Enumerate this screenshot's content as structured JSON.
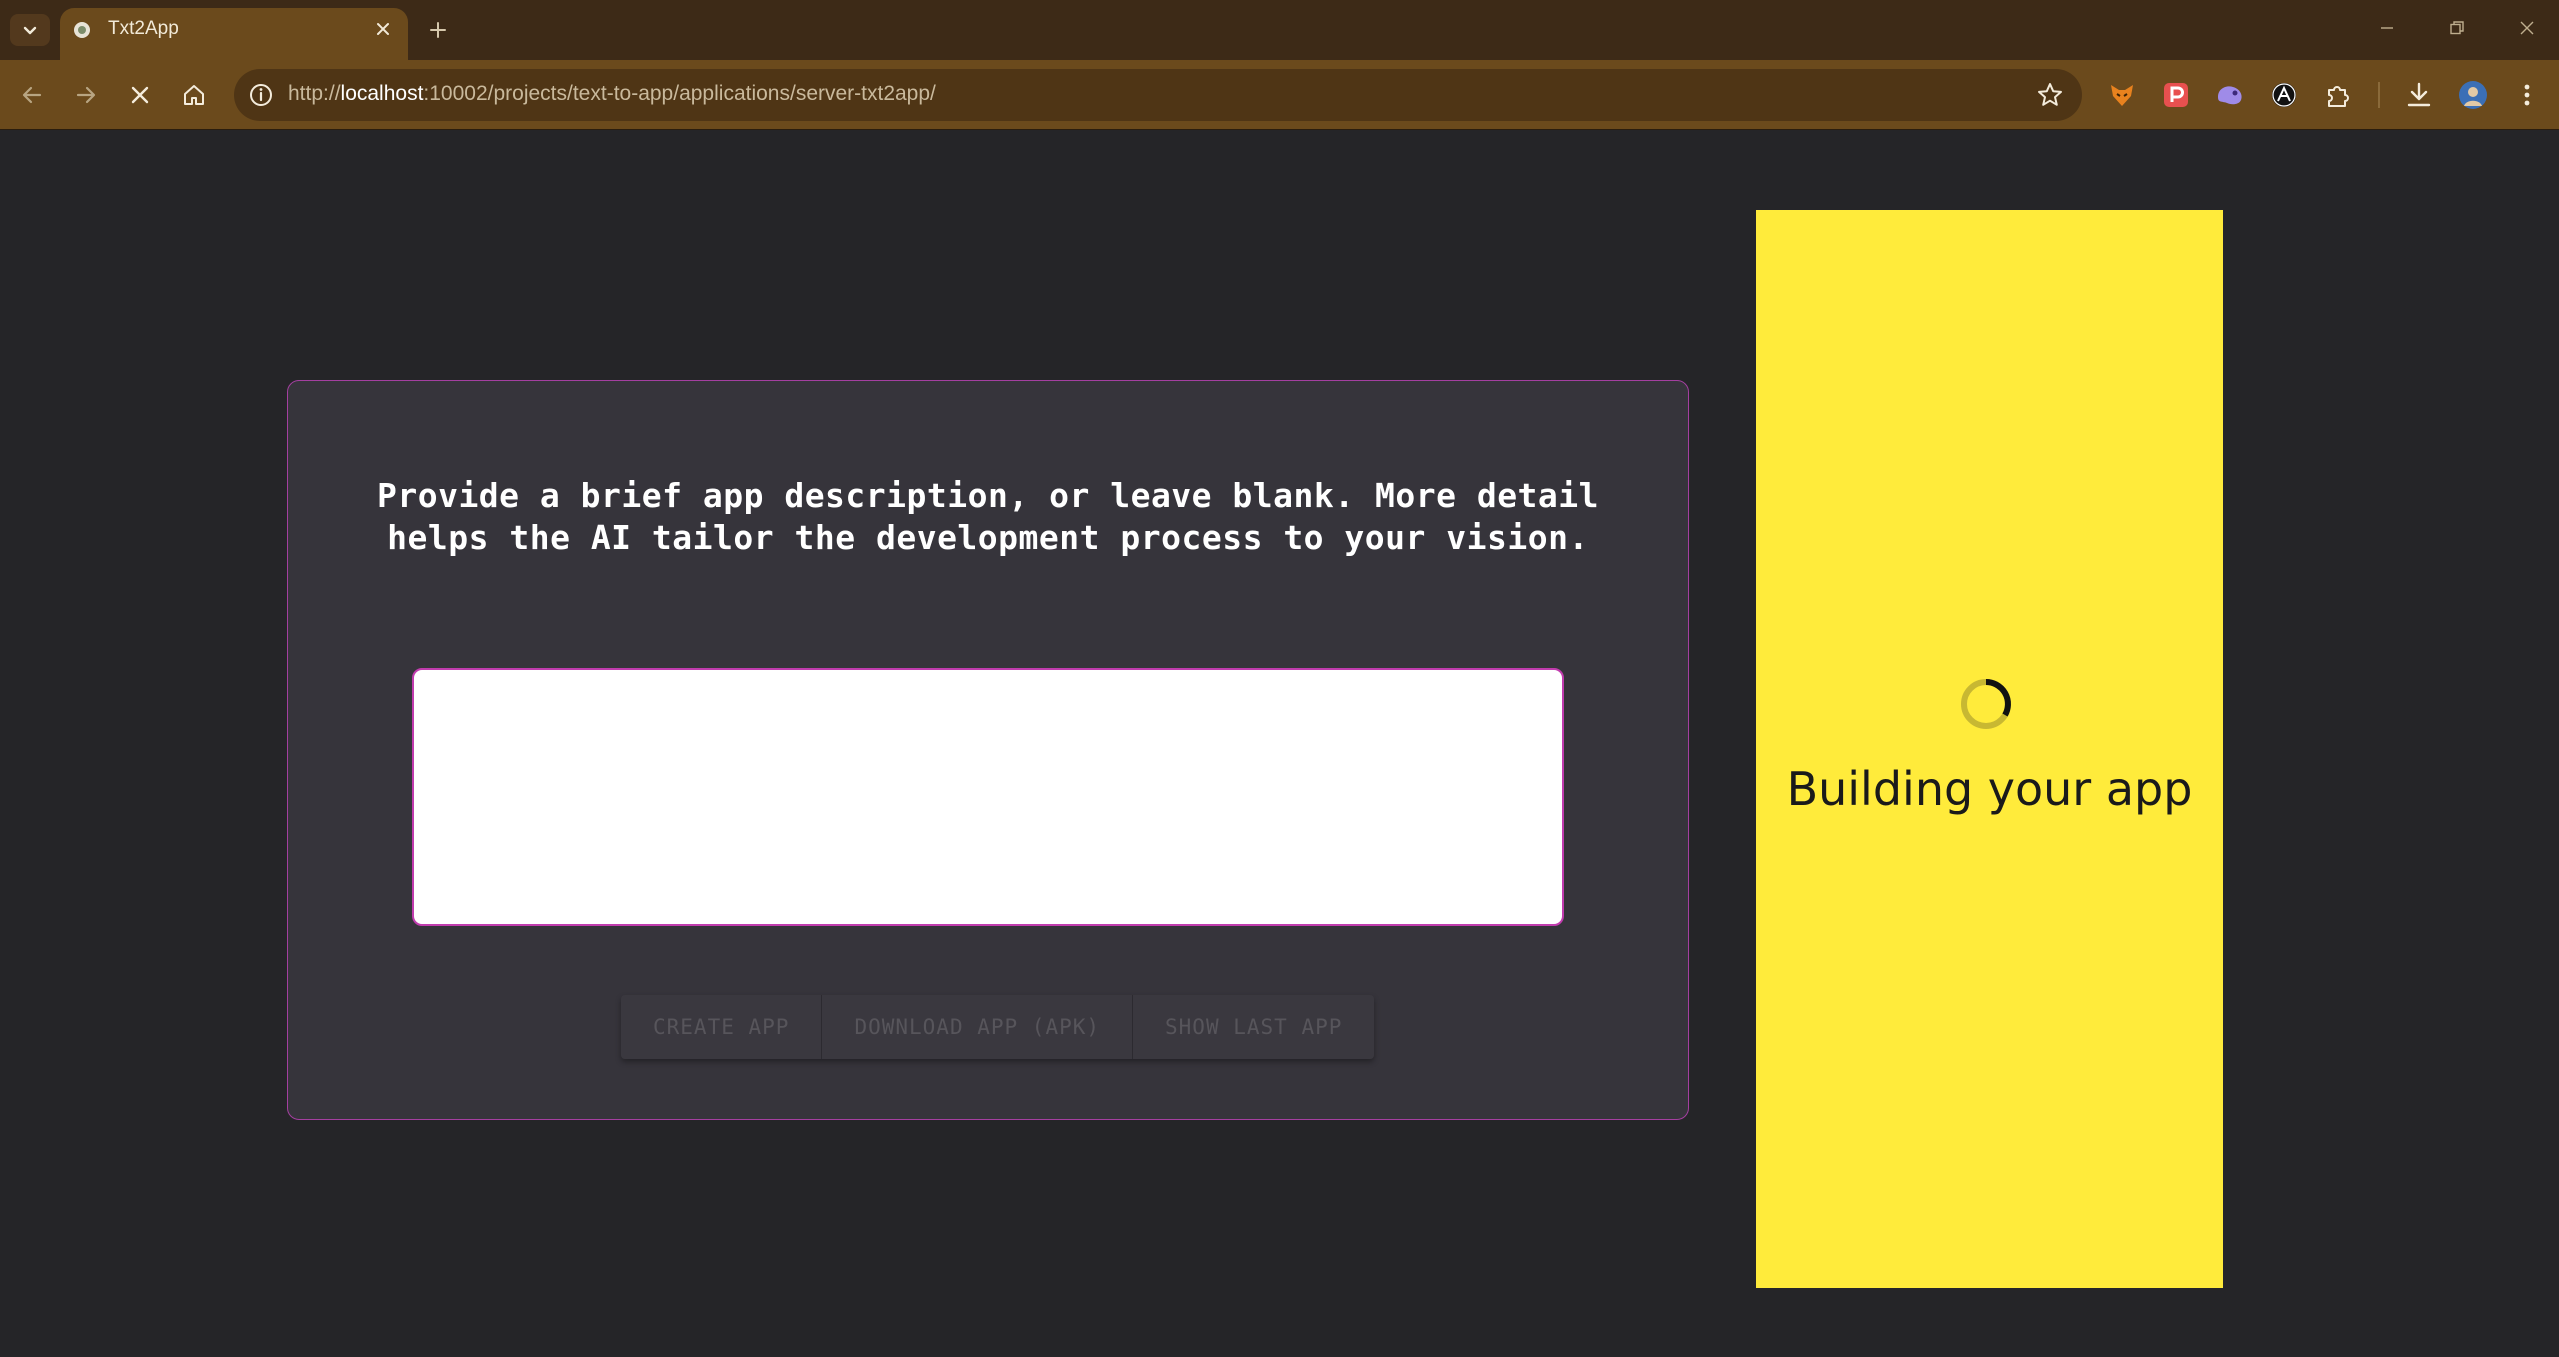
{
  "browser": {
    "tab_title": "Txt2App",
    "url_scheme": "http://",
    "url_host": "localhost",
    "url_rest": ":10002/projects/text-to-app/applications/server-txt2app/",
    "loading": true
  },
  "page": {
    "prompt_text": "Provide a brief app description, or leave blank. More detail helps the AI tailor the development process to your vision.",
    "description_value": "",
    "buttons": {
      "create": "CREATE APP",
      "download": "DOWNLOAD APP (APK)",
      "show_last": "SHOW LAST APP"
    },
    "buttons_disabled": true,
    "status_text": "Building your app"
  },
  "colors": {
    "page_bg": "#252528",
    "card_bg": "#36343b",
    "card_border": "#a43fa0",
    "side_panel_bg": "#ffeb3b",
    "chrome_tabbar": "#3d2a17",
    "chrome_toolbar": "#6b4a1c"
  },
  "icons": {
    "tab_menu": "chevron-down-icon",
    "favicon": "app-favicon-icon",
    "tab_close": "close-icon",
    "new_tab": "plus-icon",
    "back": "arrow-left-icon",
    "forward": "arrow-right-icon",
    "stop": "stop-loading-icon",
    "home": "home-icon",
    "site_info": "info-icon",
    "bookmark": "star-icon",
    "extensions": [
      "fox-extension-icon",
      "p-extension-icon",
      "blob-extension-icon",
      "a-extension-icon",
      "puzzle-icon"
    ],
    "downloads": "download-icon",
    "profile": "avatar-icon",
    "menu": "kebab-menu-icon",
    "spinner": "loading-spinner-icon"
  }
}
